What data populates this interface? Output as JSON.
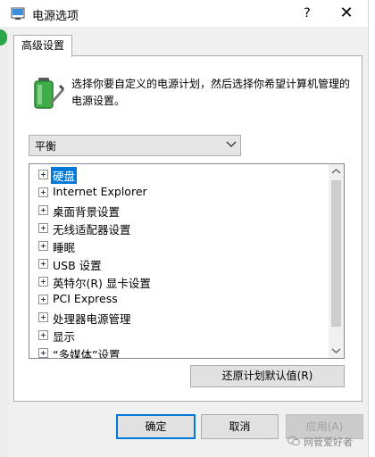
{
  "window": {
    "title": "电源选项",
    "help_label": "?",
    "close_label": "✕"
  },
  "tab": {
    "label": "高级设置"
  },
  "description": "选择你要自定义的电源计划，然后选择你希望计算机管理的电源设置。",
  "plan_select": {
    "value": "平衡"
  },
  "settings_tree": [
    {
      "label": "硬盘",
      "selected": true
    },
    {
      "label": "Internet Explorer"
    },
    {
      "label": "桌面背景设置"
    },
    {
      "label": "无线适配器设置"
    },
    {
      "label": "睡眠"
    },
    {
      "label": "USB 设置"
    },
    {
      "label": "英特尔(R) 显卡设置"
    },
    {
      "label": "PCI Express"
    },
    {
      "label": "处理器电源管理"
    },
    {
      "label": "显示"
    },
    {
      "label": "“多媒体”设置"
    }
  ],
  "restore_button": "还原计划默认值(R)",
  "buttons": {
    "ok": "确定",
    "cancel": "取消",
    "apply": "应用(A)"
  },
  "watermark": "网管爱好者",
  "colors": {
    "accent": "#0078d7",
    "battery_green": "#3fae49"
  }
}
